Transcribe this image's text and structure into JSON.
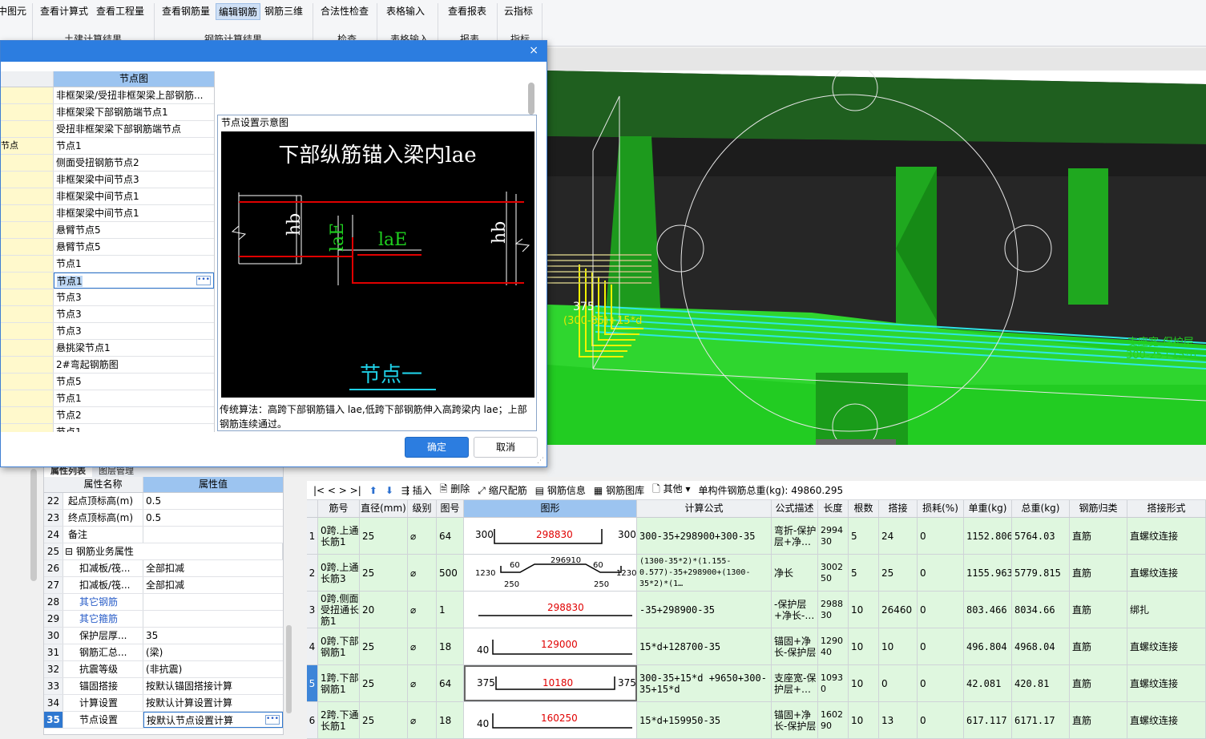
{
  "ribbon": {
    "buttons": [
      "中图元",
      "查看计算式",
      "查看工程量",
      "查看钢筋量",
      "编辑钢筋",
      "钢筋三维",
      "合法性检查",
      "表格输入",
      "查看报表",
      "云指标"
    ],
    "groups": [
      "土建计算结果",
      "钢筋计算结果",
      "检查",
      "表格输入",
      "报表",
      "指标"
    ]
  },
  "dialog": {
    "close_glyph": "×",
    "list_header": "节点图",
    "left_cell_label": "节点",
    "items": [
      "非框架梁/受扭非框架梁上部钢筋...",
      "非框架梁下部钢筋端节点1",
      "受扭非框架梁下部钢筋端节点",
      "节点1",
      "侧面受扭钢筋节点2",
      "非框架梁中间节点3",
      "非框架梁中间节点1",
      "非框架梁中间节点1",
      "悬臂节点5",
      "悬臂节点5",
      "节点1",
      "节点1",
      "节点3",
      "节点3",
      "节点3",
      "悬挑梁节点1",
      "2#弯起钢筋图",
      "节点5",
      "节点1",
      "节点2",
      "节点1"
    ],
    "selected_index": 11,
    "preview": {
      "title": "节点设置示意图",
      "image_title": "下部纵筋锚入梁内lae",
      "label_hb": "hb",
      "label_lae_vertical": "laE",
      "label_lae_horizontal": "laE",
      "caption": "节点一",
      "description": "传统算法：高跨下部钢筋锚入 lae,低跨下部钢筋伸入高跨梁内 lae；上部钢筋连续通过。"
    },
    "ok": "确定",
    "cancel": "取消"
  },
  "scene": {
    "label_number": "375",
    "label_text": "(300-35)+15*d",
    "right_label1": "支座宽-保护层",
    "right_label2": "300-25+15*d"
  },
  "props": {
    "tabs": [
      "属性列表",
      "图层管理"
    ],
    "header_name": "属性名称",
    "header_value": "属性值",
    "rows": [
      {
        "n": "22",
        "k": "起点顶标高(m)",
        "v": "0.5"
      },
      {
        "n": "23",
        "k": "终点顶标高(m)",
        "v": "0.5"
      },
      {
        "n": "24",
        "k": "备注",
        "v": ""
      },
      {
        "n": "25",
        "k": "⊟ 钢筋业务属性",
        "v": ""
      },
      {
        "n": "26",
        "k": "扣减板/筏...",
        "v": "全部扣减"
      },
      {
        "n": "27",
        "k": "扣减板/筏...",
        "v": "全部扣减"
      },
      {
        "n": "28",
        "k": "其它钢筋",
        "v": ""
      },
      {
        "n": "29",
        "k": "其它箍筋",
        "v": ""
      },
      {
        "n": "30",
        "k": "保护层厚...",
        "v": "35"
      },
      {
        "n": "31",
        "k": "钢筋汇总...",
        "v": "(梁)"
      },
      {
        "n": "32",
        "k": "抗震等级",
        "v": "(非抗震)"
      },
      {
        "n": "33",
        "k": "锚固搭接",
        "v": "按默认锚固搭接计算"
      },
      {
        "n": "34",
        "k": "计算设置",
        "v": "按默认计算设置计算"
      },
      {
        "n": "35",
        "k": "节点设置",
        "v": "按默认节点设置计算"
      }
    ]
  },
  "grid": {
    "toolbar": {
      "nav": "|<  <  >  >|",
      "insert": "插入",
      "delete": "删除",
      "scale": "缩尺配筋",
      "info": "钢筋信息",
      "library": "钢筋图库",
      "other": "其他",
      "total": "单构件钢筋总重(kg): 49860.295"
    },
    "headers": [
      "筋号",
      "直径(mm)",
      "级别",
      "图号",
      "图形",
      "计算公式",
      "公式描述",
      "长度",
      "根数",
      "搭接",
      "损耗(%)",
      "单重(kg)",
      "总重(kg)",
      "钢筋归类",
      "搭接形式"
    ],
    "level_symbol": "⌀",
    "rows": [
      {
        "n": "1",
        "name": "0跨.上通长筋1",
        "dia": "25",
        "fig": "64",
        "formula": "300-35+298900+300-35",
        "desc": "弯折-保护层+净…",
        "len": "299430",
        "qty": "5",
        "lap": "24",
        "loss": "0",
        "unit": "1152.806",
        "total": "5764.03",
        "cls": "直筋",
        "lapf": "直螺纹连接",
        "shape": {
          "left": "300",
          "mid": "298830",
          "right": "300"
        }
      },
      {
        "n": "2",
        "name": "0跨.上通长筋3",
        "dia": "25",
        "fig": "500",
        "formula": "(1300-35*2)*(1.155-0.577)-35+298900+(1300-35*2)*(1…",
        "desc": "净长",
        "len": "300250",
        "qty": "5",
        "lap": "25",
        "loss": "0",
        "unit": "1155.963",
        "total": "5779.815",
        "cls": "直筋",
        "lapf": "直螺纹连接",
        "shape": {
          "left": "1230",
          "a1": "60",
          "mid": "296910",
          "a2": "60",
          "right": "1230",
          "b1": "250",
          "b2": "250"
        }
      },
      {
        "n": "3",
        "name": "0跨.侧面受扭通长筋1",
        "dia": "20",
        "fig": "1",
        "formula": "-35+298900-35",
        "desc": "-保护层+净长-…",
        "len": "298830",
        "qty": "10",
        "lap": "26460",
        "loss": "0",
        "unit": "803.466",
        "total": "8034.66",
        "cls": "直筋",
        "lapf": "绑扎",
        "shape": {
          "mid": "298830"
        }
      },
      {
        "n": "4",
        "name": "0跨.下部钢筋1",
        "dia": "25",
        "fig": "18",
        "formula": "15*d+128700-35",
        "desc": "锚固+净长-保护层",
        "len": "129040",
        "qty": "10",
        "lap": "10",
        "loss": "0",
        "unit": "496.804",
        "total": "4968.04",
        "cls": "直筋",
        "lapf": "直螺纹连接",
        "shape": {
          "left": "40",
          "mid": "129000"
        }
      },
      {
        "n": "5",
        "name": "1跨.下部钢筋1",
        "dia": "25",
        "fig": "64",
        "formula": "300-35+15*d +9650+300-35+15*d",
        "desc": "支座宽-保护层+…",
        "len": "10930",
        "qty": "10",
        "lap": "0",
        "loss": "0",
        "unit": "42.081",
        "total": "420.81",
        "cls": "直筋",
        "lapf": "直螺纹连接",
        "shape": {
          "left": "375",
          "mid": "10180",
          "right": "375"
        }
      },
      {
        "n": "6",
        "name": "2跨.下通长筋1",
        "dia": "25",
        "fig": "18",
        "formula": "15*d+159950-35",
        "desc": "锚固+净长-保护层",
        "len": "160290",
        "qty": "10",
        "lap": "13",
        "loss": "0",
        "unit": "617.117",
        "total": "6171.17",
        "cls": "直筋",
        "lapf": "直螺纹连接",
        "shape": {
          "left": "40",
          "mid": "160250"
        }
      }
    ]
  }
}
